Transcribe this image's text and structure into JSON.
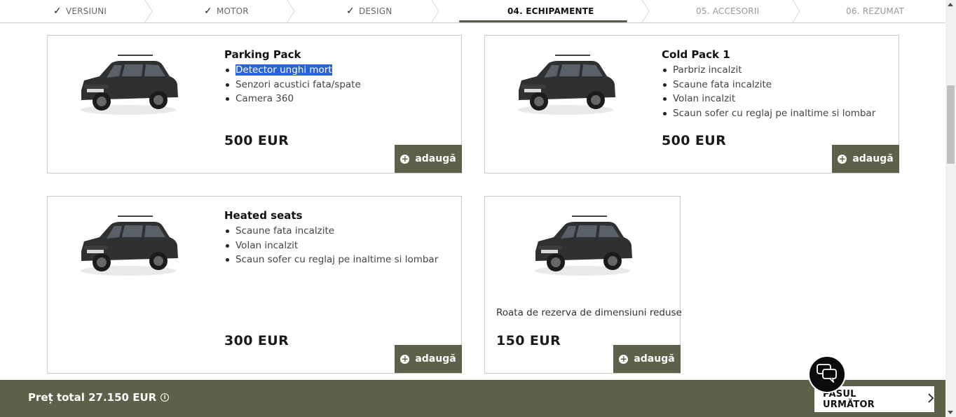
{
  "steps": [
    {
      "label": "VERSIUNI",
      "state": "done"
    },
    {
      "label": "MOTOR",
      "state": "done"
    },
    {
      "label": "DESIGN",
      "state": "done"
    },
    {
      "label": "04. ECHIPAMENTE",
      "state": "active"
    },
    {
      "label": "05. ACCESORII",
      "state": "future"
    },
    {
      "label": "06. REZUMAT",
      "state": "future"
    }
  ],
  "cards": [
    {
      "title": "Parking Pack",
      "items": [
        "Detector unghi mort",
        "Senzori acustici fata/spate",
        "Camera 360"
      ],
      "selected_item": "Detector unghi mort",
      "price": "500 EUR",
      "button": "adaugă"
    },
    {
      "title": "Cold Pack 1",
      "items": [
        "Parbriz incalzit",
        "Scaune fata incalzite",
        "Volan incalzit",
        "Scaun sofer cu reglaj pe inaltime si lombar"
      ],
      "price": "500 EUR",
      "button": "adaugă"
    },
    {
      "title": "Heated seats",
      "items": [
        "Scaune fata incalzite",
        "Volan incalzit",
        "Scaun sofer cu reglaj pe inaltime si lombar"
      ],
      "price": "300 EUR",
      "button": "adaugă"
    },
    {
      "description": "Roata de rezerva de dimensiuni reduse",
      "price": "150 EUR",
      "button": "adaugă"
    }
  ],
  "footer": {
    "total_label": "Preț total 27.150 EUR",
    "next_label": "PASUL URMĂTOR"
  },
  "colors": {
    "accent": "#5c6249",
    "selection": "#2a63d6"
  },
  "icons": [
    "check-icon",
    "plus-circle-icon",
    "info-icon",
    "chevron-right-icon",
    "chat-icon",
    "car-image"
  ]
}
